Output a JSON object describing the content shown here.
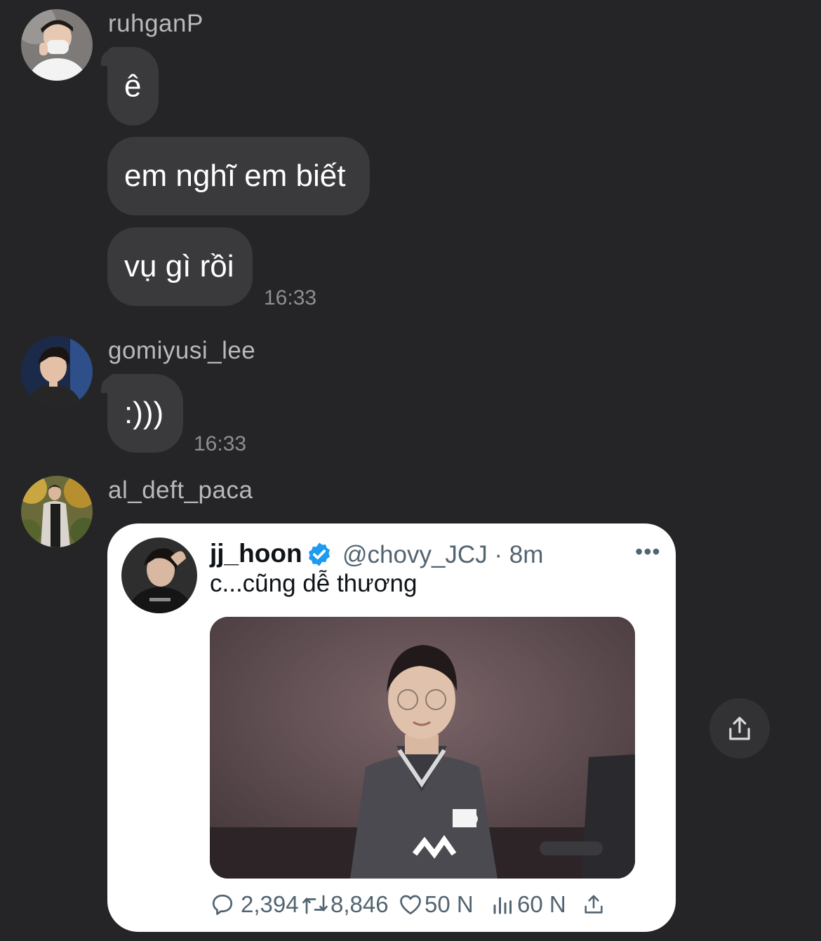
{
  "messages": [
    {
      "sender": "ruhganP",
      "bubbles": [
        "ê",
        "em nghĩ em biết",
        "vụ gì rồi"
      ],
      "time": "16:33"
    },
    {
      "sender": "gomiyusi_lee",
      "bubbles": [
        ":)))"
      ],
      "time": "16:33"
    },
    {
      "sender": "al_deft_paca",
      "tweet": {
        "name": "jj_hoon",
        "handle": "@chovy_JCJ",
        "age": "8m",
        "meta": "@chovy_JCJ · 8m",
        "more": "•••",
        "text": "c...cũng dễ thương",
        "replies": "2,394",
        "retweets": "8,846",
        "likes": "50 N",
        "views": "60 N"
      }
    }
  ],
  "icons": {
    "reply": "reply-icon",
    "retweet": "retweet-icon",
    "like": "heart-icon",
    "views": "views-icon",
    "share": "share-icon",
    "verified": "verified-badge-icon"
  },
  "colors": {
    "background": "#252528",
    "bubble": "#3a3a3d",
    "sender": "#b9b9bd",
    "timestamp": "#8e8e93",
    "verified": "#1d9bf0"
  }
}
